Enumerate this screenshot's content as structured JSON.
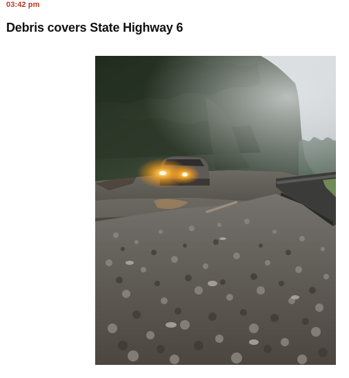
{
  "post": {
    "timestamp": "03:42 pm",
    "headline": "Debris covers State Highway 6"
  },
  "photo": {
    "subject": "debris-on-highway",
    "colors": {
      "sky": "#c9cfd3",
      "forest": "#2f3a2c",
      "road": "#5d5b55",
      "headlight": "#ffb12a"
    }
  }
}
